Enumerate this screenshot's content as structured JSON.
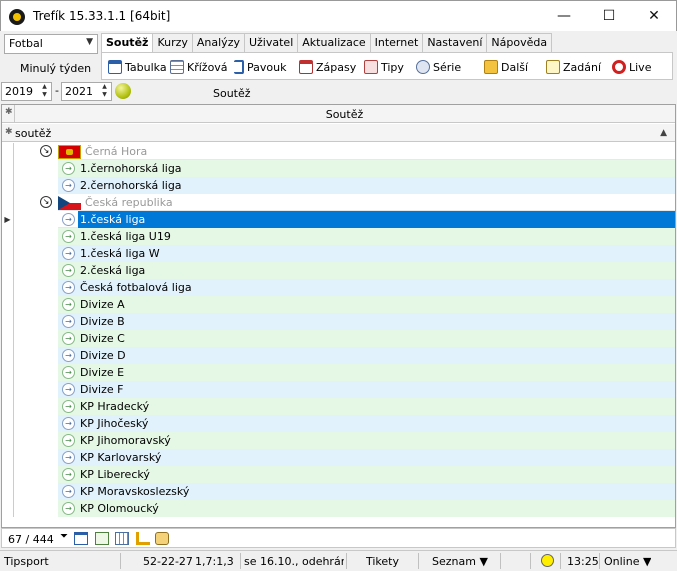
{
  "window": {
    "title": "Trefík 15.33.1.1 [64bit]",
    "minimize": "—",
    "maximize": "☐",
    "close": "✕"
  },
  "sport": {
    "selected": "Fotbal"
  },
  "period": {
    "label": "Minulý týden"
  },
  "menu": {
    "tabs": [
      "Soutěž",
      "Kurzy",
      "Analýzy",
      "Uživatel",
      "Aktualizace",
      "Internet",
      "Nastavení",
      "Nápověda"
    ]
  },
  "toolbar": {
    "tabulka": "Tabulka",
    "krizova": "Křížová",
    "pavouk": "Pavouk",
    "zapasy": "Zápasy",
    "tipy": "Tipy",
    "serie": "Série",
    "dalsi": "Další",
    "zadani": "Zadání",
    "live": "Live"
  },
  "filter": {
    "year_from": "2019",
    "year_to": "2021",
    "dash": "-",
    "label": "Soutěž"
  },
  "grid": {
    "column_title": "Soutěž",
    "group_label": "soutěž",
    "rows": {
      "cg": "Černá Hora",
      "cg1": "1.černohorská liga",
      "cg2": "2.černohorská liga",
      "cz": "Česká republika",
      "cz1": "1.česká liga",
      "cz2": "1.česká liga U19",
      "cz3": "1.česká liga W",
      "cz4": "2.česká liga",
      "cz5": "Česká fotbalová liga",
      "d1": "Divize A",
      "d2": "Divize B",
      "d3": "Divize C",
      "d4": "Divize D",
      "d5": "Divize E",
      "d6": "Divize F",
      "k1": "KP Hradecký",
      "k2": "KP Jihočeský",
      "k3": "KP Jihomoravský",
      "k4": "KP Karlovarský",
      "k5": "KP Liberecký",
      "k6": "KP Moravskoslezský",
      "k7": "KP Olomoucký"
    }
  },
  "footer": {
    "count": "67 / 444"
  },
  "status": {
    "bookmaker": "Tipsport",
    "record": "52-22-27",
    "odds": "1,7:1,3",
    "message": "se 16.10., odehránc",
    "tickets": "Tikety",
    "list": "Seznam ▼",
    "time": "13:25",
    "online": "Online ▼"
  },
  "colors": {
    "selection": "#0078d7",
    "green_row": "#e5f8e5",
    "blue_row": "#e1f2fc"
  }
}
